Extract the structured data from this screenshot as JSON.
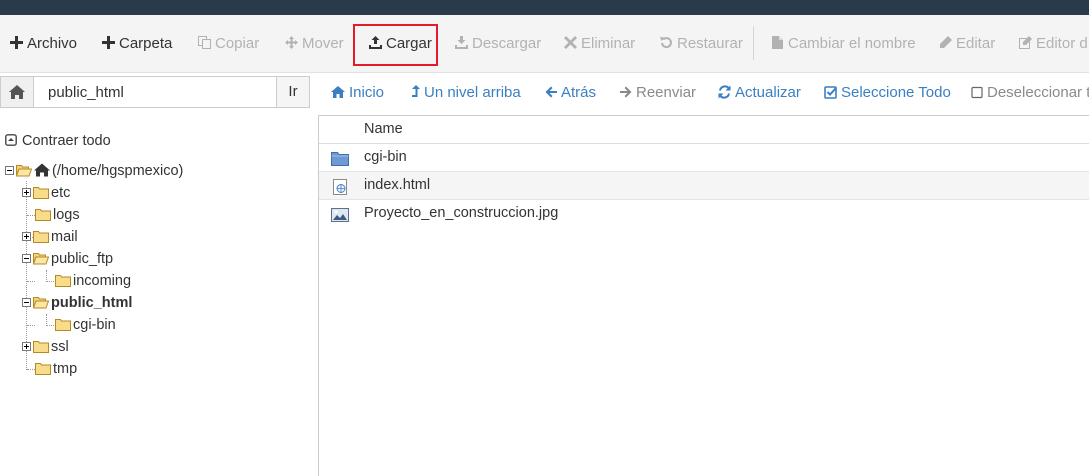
{
  "toolbar": {
    "items": [
      {
        "label": "Archivo",
        "icon": "plus-icon",
        "enabled": true
      },
      {
        "label": "Carpeta",
        "icon": "plus-icon",
        "enabled": true
      },
      {
        "label": "Copiar",
        "icon": "copy-icon",
        "enabled": false
      },
      {
        "label": "Mover",
        "icon": "move-icon",
        "enabled": false
      },
      {
        "label": "Cargar",
        "icon": "upload-icon",
        "enabled": true,
        "highlighted": true
      },
      {
        "label": "Descargar",
        "icon": "download-icon",
        "enabled": false
      },
      {
        "label": "Eliminar",
        "icon": "close-icon",
        "enabled": false
      },
      {
        "label": "Restaurar",
        "icon": "undo-icon",
        "enabled": false
      },
      {
        "label": "Cambiar el nombre",
        "icon": "file-icon",
        "enabled": false
      },
      {
        "label": "Editar",
        "icon": "pencil-icon",
        "enabled": false
      },
      {
        "label": "Editor d",
        "icon": "edit-icon",
        "enabled": false
      }
    ],
    "highlight_color": "#e21b2d"
  },
  "path": {
    "value": "public_html",
    "go_label": "Ir"
  },
  "nav": {
    "items": [
      {
        "label": "Inicio",
        "icon": "home-icon",
        "enabled": true
      },
      {
        "label": "Un nivel arriba",
        "icon": "level-up-icon",
        "enabled": true
      },
      {
        "label": "Atrás",
        "icon": "arrow-left-icon",
        "enabled": true
      },
      {
        "label": "Reenviar",
        "icon": "arrow-right-icon",
        "enabled": false
      },
      {
        "label": "Actualizar",
        "icon": "refresh-icon",
        "enabled": true
      },
      {
        "label": "Seleccione Todo",
        "icon": "checkbox-checked-icon",
        "enabled": true
      },
      {
        "label": "Deseleccionar to",
        "icon": "checkbox-empty-icon",
        "enabled": false
      }
    ],
    "link_color": "#3a7fc1"
  },
  "tree": {
    "collapse_label": "Contraer todo",
    "root_label": "(/home/hgspmexico)",
    "nodes": [
      {
        "label": "etc"
      },
      {
        "label": "logs"
      },
      {
        "label": "mail"
      },
      {
        "label": "public_ftp"
      },
      {
        "label": "incoming"
      },
      {
        "label": "public_html",
        "selected": true
      },
      {
        "label": "cgi-bin"
      },
      {
        "label": "ssl"
      },
      {
        "label": "tmp"
      }
    ]
  },
  "files": {
    "header_name": "Name",
    "rows": [
      {
        "name": "cgi-bin",
        "icon": "folder-icon"
      },
      {
        "name": "index.html",
        "icon": "html-file-icon"
      },
      {
        "name": "Proyecto_en_construccion.jpg",
        "icon": "image-file-icon"
      }
    ]
  }
}
